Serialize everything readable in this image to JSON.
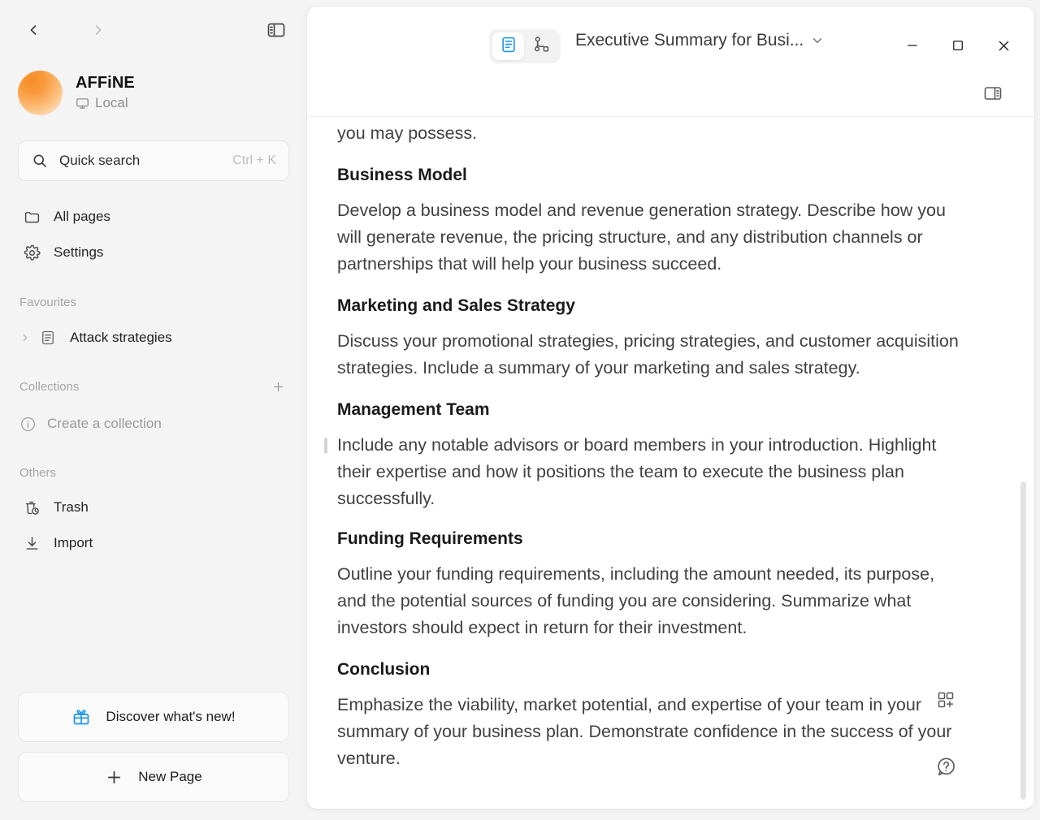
{
  "sidebar": {
    "nav": {
      "back_icon": "chevron-left-icon",
      "forward_icon": "chevron-right-icon",
      "collapse_icon": "sidebar-toggle-icon"
    },
    "workspace": {
      "name": "AFFiNE",
      "status": "Local",
      "status_icon": "monitor-icon",
      "avatar_colors": [
        "#f78c2a",
        "#fdf1e4"
      ]
    },
    "search": {
      "label": "Quick search",
      "shortcut": "Ctrl + K",
      "icon": "search-icon"
    },
    "main_items": [
      {
        "label": "All pages",
        "icon": "folder-icon"
      },
      {
        "label": "Settings",
        "icon": "gear-icon"
      }
    ],
    "favourites": {
      "title": "Favourites",
      "items": [
        {
          "label": "Attack strategies",
          "icon": "doc-icon",
          "expand_icon": "chevron-right-icon"
        }
      ]
    },
    "collections": {
      "title": "Collections",
      "add_icon": "plus-icon",
      "empty_label": "Create a collection",
      "empty_icon": "info-icon"
    },
    "others": {
      "title": "Others",
      "items": [
        {
          "label": "Trash",
          "icon": "trash-clock-icon"
        },
        {
          "label": "Import",
          "icon": "download-icon"
        }
      ]
    },
    "bottom_buttons": [
      {
        "label": "Discover what's new!",
        "icon": "gift-icon",
        "accent": "#1e96eb"
      },
      {
        "label": "New Page",
        "icon": "plus-icon"
      }
    ]
  },
  "window": {
    "mode_switch": {
      "page_mode": {
        "icon": "page-mode-icon",
        "active": true
      },
      "edgeless_mode": {
        "icon": "edgeless-mode-icon",
        "active": false
      }
    },
    "doc_title": "Executive Summary for Busi...",
    "doc_title_chevron": "chevron-down-icon",
    "controls": {
      "minimize": "minimize-icon",
      "maximize": "maximize-icon",
      "close": "close-icon"
    },
    "right_panel_toggle_icon": "right-sidebar-toggle-icon"
  },
  "document": {
    "blocks": [
      {
        "type": "paragraph",
        "text": "you may possess.",
        "partial_top": true
      },
      {
        "type": "heading",
        "text": "Business Model"
      },
      {
        "type": "paragraph",
        "text": "Develop a business model and revenue generation strategy. Describe how you will generate revenue, the pricing structure, and any distribution channels or partnerships that will help your business succeed."
      },
      {
        "type": "heading",
        "text": "Marketing and Sales Strategy"
      },
      {
        "type": "paragraph",
        "text": "Discuss your promotional strategies, pricing strategies, and customer acquisition strategies. Include a summary of your marketing and sales strategy."
      },
      {
        "type": "heading",
        "text": "Management Team"
      },
      {
        "type": "paragraph",
        "text": "Include any notable advisors or board members in your introduction. Highlight their expertise and how it positions the team to execute the business plan successfully.",
        "has_drag_handle": true
      },
      {
        "type": "heading",
        "text": "Funding Requirements"
      },
      {
        "type": "paragraph",
        "text": "Outline your funding requirements, including the amount needed, its purpose, and the potential sources of funding you are considering. Summarize what investors should expect in return for their investment."
      },
      {
        "type": "heading",
        "text": "Conclusion"
      },
      {
        "type": "paragraph",
        "text": "Emphasize the viability, market potential, and expertise of your team in your summary of your business plan. Demonstrate confidence in the success of your venture."
      }
    ],
    "floating": {
      "widget_icon": "add-widget-icon",
      "help_icon": "help-question-icon"
    },
    "scrollbar": {
      "name": "vertical-scrollbar"
    }
  }
}
